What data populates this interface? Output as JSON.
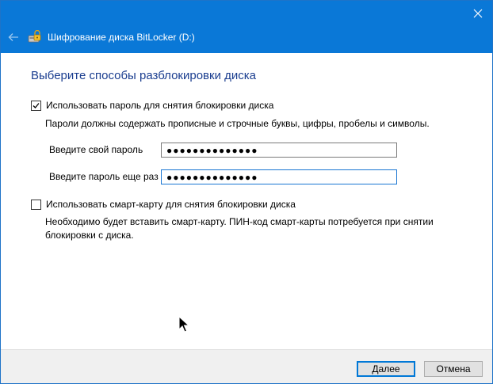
{
  "window": {
    "title": "Шифрование диска BitLocker (D:)",
    "close_icon": "close-icon",
    "back_icon": "back-arrow-icon",
    "app_icon": "bitlocker-icon",
    "accent_color": "#0a78d7"
  },
  "main": {
    "heading": "Выберите способы разблокировки диска",
    "password_option": {
      "label": "Использовать пароль для снятия блокировки диска",
      "checked": true,
      "description": "Пароли должны содержать прописные и строчные буквы, цифры, пробелы и символы.",
      "enter_label": "Введите свой пароль",
      "enter_value": "●●●●●●●●●●●●●●",
      "confirm_label": "Введите пароль еще раз",
      "confirm_value": "●●●●●●●●●●●●●●"
    },
    "smartcard_option": {
      "label": "Использовать смарт-карту для снятия блокировки диска",
      "checked": false,
      "description": "Необходимо будет вставить смарт-карту. ПИН-код смарт-карты потребуется при снятии блокировки с диска."
    }
  },
  "footer": {
    "next_label": "Далее",
    "cancel_label": "Отмена"
  }
}
